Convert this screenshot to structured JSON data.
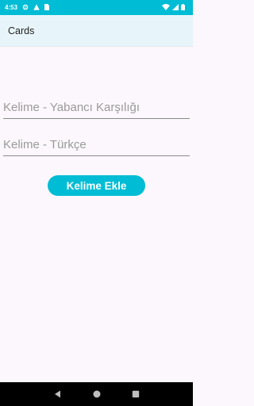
{
  "status_bar": {
    "time": "4:53",
    "color": "#00BCD4"
  },
  "app_bar": {
    "title": "Cards"
  },
  "form": {
    "foreign_placeholder": "Kelime - Yabancı Karşılığı",
    "foreign_value": "",
    "turkish_placeholder": "Kelime - Türkçe",
    "turkish_value": "",
    "add_button": "Kelime Ekle"
  },
  "icons": {
    "status": [
      "gear-icon",
      "warning-icon",
      "sim-card-icon",
      "wifi-icon",
      "signal-icon",
      "battery-icon"
    ],
    "nav": [
      "back-icon",
      "home-icon",
      "recents-icon"
    ]
  },
  "colors": {
    "accent": "#00BCD4",
    "app_bar": "#E7F5FA",
    "background": "#FCF7FC"
  }
}
